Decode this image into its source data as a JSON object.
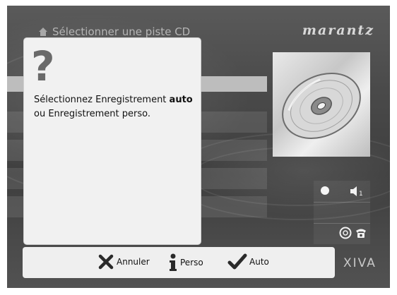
{
  "header": {
    "title": "Sélectionner une piste CD",
    "brand": "marantz"
  },
  "dialog": {
    "icon": "?",
    "text_part1": "Sélectionnez Enregistrement ",
    "text_bold": "auto",
    "text_part2": " ou Enregistrement perso."
  },
  "status_panel": {
    "volume_level": "1"
  },
  "bottom_bar": {
    "cancel_label": "Annuler",
    "perso_label": "Perso",
    "auto_label": "Auto"
  },
  "footer": {
    "logo": "XIVA"
  },
  "icons": {
    "header": "home-icon",
    "cd": "cd-disc-icon",
    "record": "record-dot-icon",
    "volume": "speaker-icon",
    "disc": "disc-icon",
    "phone": "phone-icon",
    "cancel": "x-icon",
    "perso": "info-icon",
    "auto": "checkmark-icon"
  }
}
